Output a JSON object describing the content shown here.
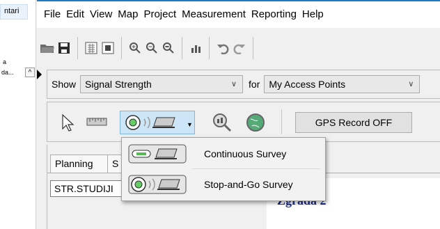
{
  "left_window": {
    "title_fragment": "ntari",
    "item1": "a",
    "item2": "da...",
    "collapse_glyph": "^"
  },
  "menu": [
    "File",
    "Edit",
    "View",
    "Map",
    "Project",
    "Measurement",
    "Reporting",
    "Help"
  ],
  "toolbar": {
    "icons": [
      "open-folder-icon",
      "save-icon",
      "grid-icon",
      "import-icon",
      "zoom-in-icon",
      "zoom-out-icon",
      "zoom-fit-icon",
      "bar-chart-icon",
      "undo-icon",
      "redo-icon"
    ]
  },
  "show_row": {
    "show_label": "Show",
    "metric_value": "Signal Strength",
    "for_label": "for",
    "target_value": "My Access Points"
  },
  "tools_row": {
    "icons": [
      "pointer-arrow-icon",
      "ruler-icon",
      "survey-mode-icon",
      "find-icon",
      "globe-icon"
    ],
    "gps_button": "GPS Record OFF"
  },
  "tabs": {
    "planning": "Planning",
    "partial": "S",
    "field_value": "STR.STUDIJI"
  },
  "map_label": "Zgrada 2",
  "survey_menu": {
    "items": [
      {
        "label": "Continuous Survey",
        "icon": "continuous-survey-icon"
      },
      {
        "label": "Stop-and-Go Survey",
        "icon": "stop-and-go-survey-icon"
      }
    ]
  },
  "colors": {
    "accent": "#1e78c8",
    "selected_button": "#cde6f7",
    "map_text": "#1b2a8c"
  }
}
